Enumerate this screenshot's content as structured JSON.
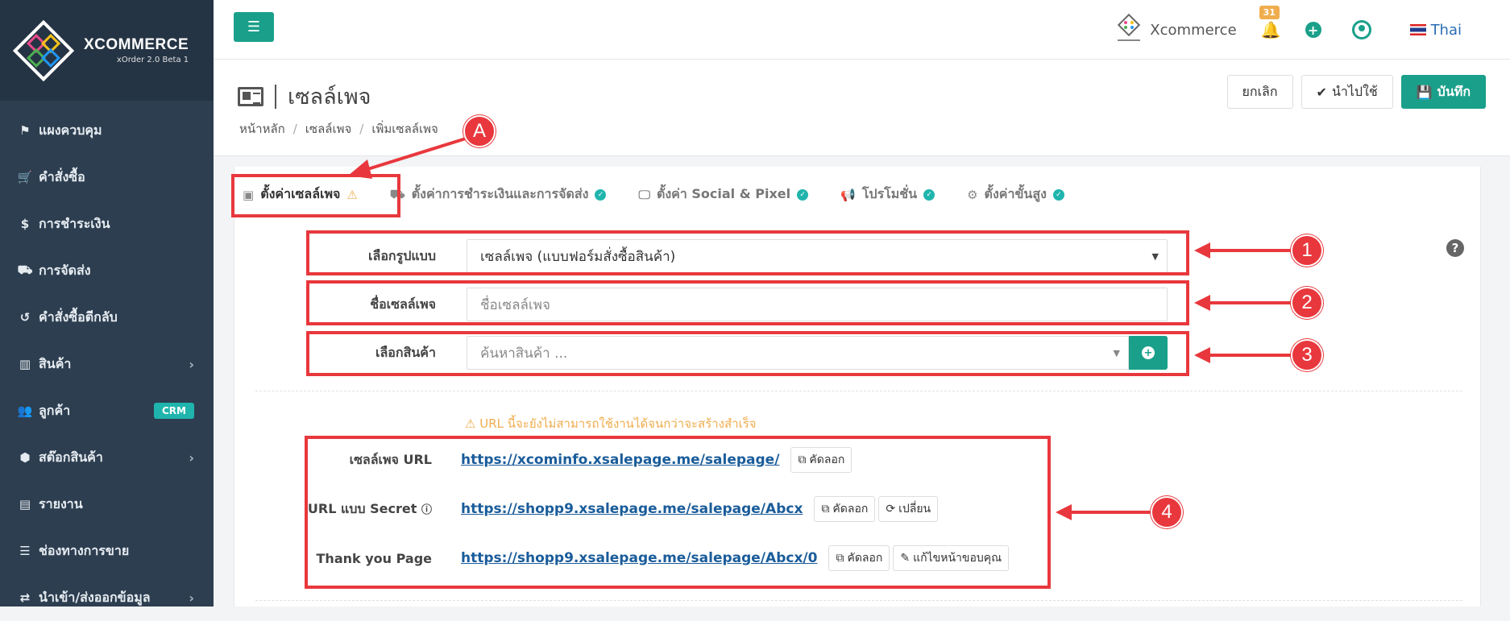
{
  "brand": {
    "name": "XCOMMERCE",
    "version": "xOrder 2.0 Beta 1"
  },
  "sidebar": {
    "items": [
      {
        "label": "แผงควบคุม",
        "icon": "flag-icon"
      },
      {
        "label": "คำสั่งซื้อ",
        "icon": "cart-icon"
      },
      {
        "label": "การชำระเงิน",
        "icon": "dollar-icon"
      },
      {
        "label": "การจัดส่ง",
        "icon": "truck-icon"
      },
      {
        "label": "คำสั่งซื้อตีกลับ",
        "icon": "undo-icon"
      },
      {
        "label": "สินค้า",
        "icon": "barcode-icon"
      },
      {
        "label": "ลูกค้า",
        "icon": "users-icon",
        "badge": "CRM"
      },
      {
        "label": "สต๊อกสินค้า",
        "icon": "cubes-icon"
      },
      {
        "label": "รายงาน",
        "icon": "bar-chart-icon"
      },
      {
        "label": "ช่องทางการขาย",
        "icon": "list-icon"
      },
      {
        "label": "นำเข้า/ส่งออกข้อมูล",
        "icon": "exchange-icon"
      }
    ]
  },
  "topbar": {
    "shop_name": "Xcommerce",
    "notif_count": "31",
    "language": "Thai"
  },
  "header": {
    "title": "เซลล์เพจ",
    "breadcrumbs": [
      "หน้าหลัก",
      "เซลล์เพจ",
      "เพิ่มเซลล์เพจ"
    ],
    "cancel": "ยกเลิก",
    "apply": "นำไปใช้",
    "save": "บันทึก"
  },
  "tabs": [
    {
      "label": "ตั้งค่าเซลล์เพจ",
      "status": "warning"
    },
    {
      "label": "ตั้งค่าการชำระเงินและการจัดส่ง",
      "status": "ok"
    },
    {
      "label": "ตั้งค่า Social & Pixel",
      "status": "ok"
    },
    {
      "label": "โปรโมชั่น",
      "status": "ok"
    },
    {
      "label": "ตั้งค่าขั้นสูง",
      "status": "ok"
    }
  ],
  "form": {
    "template_label": "เลือกรูปแบบ",
    "template_value": "เซลล์เพจ (แบบฟอร์มสั่งซื้อสินค้า)",
    "name_label": "ชื่อเซลล์เพจ",
    "name_placeholder": "ชื่อเซลล์เพจ",
    "product_label": "เลือกสินค้า",
    "product_placeholder": "ค้นหาสินค้า ..."
  },
  "notice": "URL นี้จะยังไม่สามารถใช้งานได้จนกว่าจะสร้างสำเร็จ",
  "urls": {
    "salepage_label": "เซลล์เพจ URL",
    "salepage_url": "https://xcominfo.xsalepage.me/salepage/",
    "secret_label": "URL แบบ Secret",
    "secret_url": "https://shopp9.xsalepage.me/salepage/Abcx",
    "thankyou_label": "Thank you Page",
    "thankyou_url": "https://shopp9.xsalepage.me/salepage/Abcx/0",
    "copy": "คัดลอก",
    "change": "เปลี่ยน",
    "edit_thankyou": "แก้ไขหน้าขอบคุณ"
  },
  "annotations": {
    "a": "A",
    "n1": "1",
    "n2": "2",
    "n3": "3",
    "n4": "4"
  },
  "colors": {
    "accent": "#1aa08a",
    "sidebar": "#2d3e50",
    "annotation": "#e8383d",
    "warning": "#f0ad4e"
  }
}
